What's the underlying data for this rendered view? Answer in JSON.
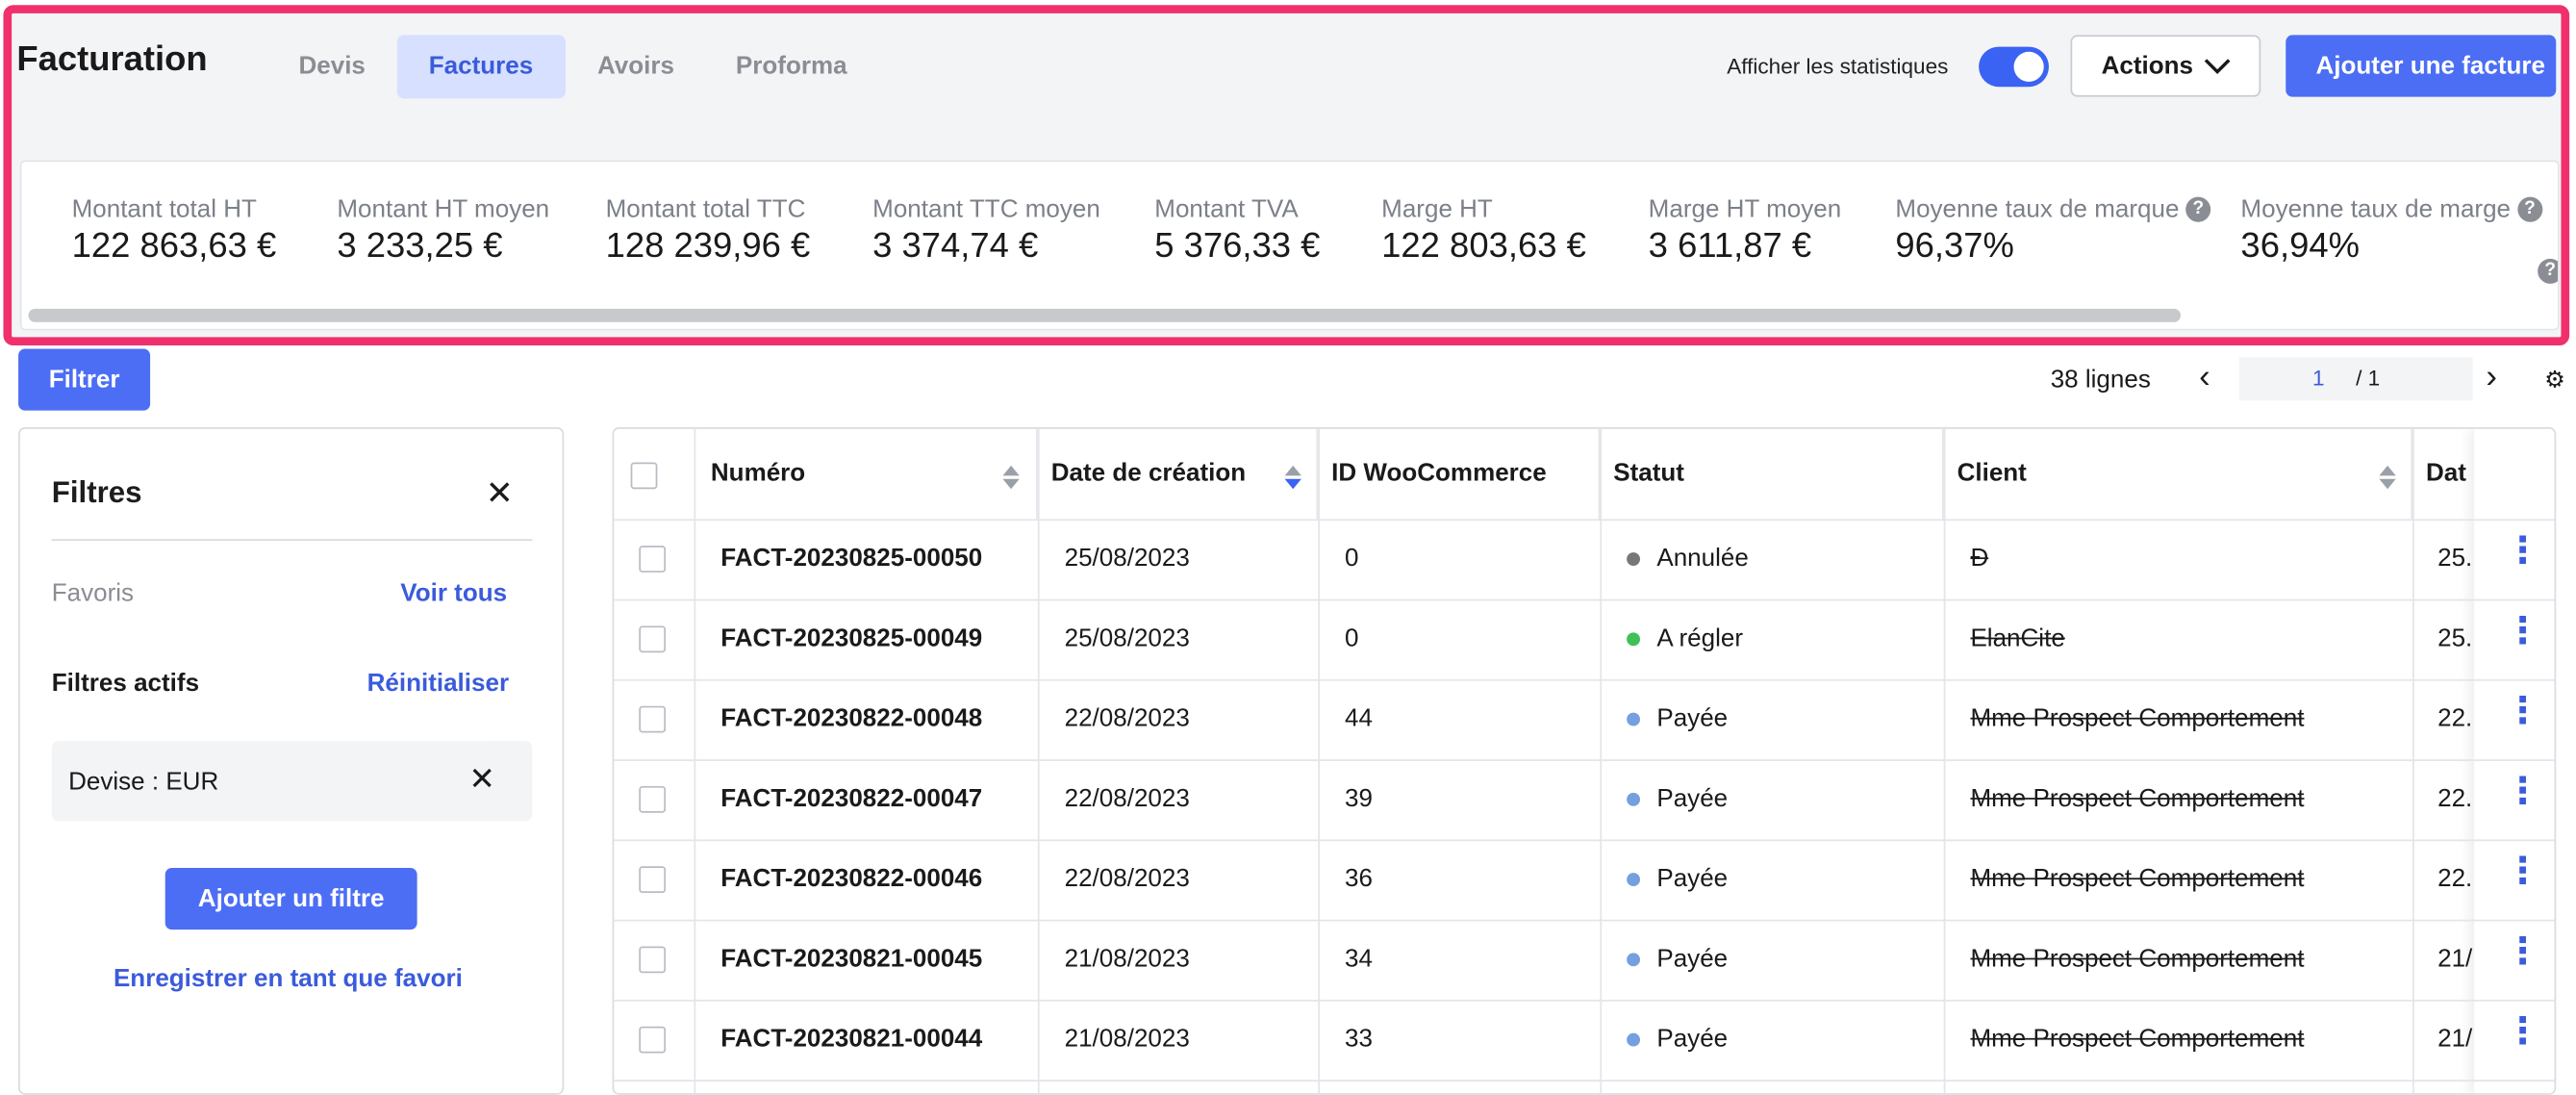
{
  "header": {
    "title": "Facturation",
    "tabs": [
      {
        "label": "Devis",
        "active": false
      },
      {
        "label": "Factures",
        "active": true
      },
      {
        "label": "Avoirs",
        "active": false
      },
      {
        "label": "Proforma",
        "active": false
      }
    ],
    "stats_toggle_label": "Afficher les statistiques",
    "stats_toggle_on": true,
    "actions_label": "Actions",
    "add_invoice_label": "Ajouter une facture",
    "accent_color": "#4c6ef5",
    "highlight_color": "#f0306c"
  },
  "stats": [
    {
      "label": "Montant total HT",
      "value": "122 863,63 €"
    },
    {
      "label": "Montant HT moyen",
      "value": "3 233,25 €"
    },
    {
      "label": "Montant total TTC",
      "value": "128 239,96 €"
    },
    {
      "label": "Montant TTC moyen",
      "value": "3 374,74 €"
    },
    {
      "label": "Montant TVA",
      "value": "5 376,33 €"
    },
    {
      "label": "Marge HT",
      "value": "122 803,63 €"
    },
    {
      "label": "Marge HT moyen",
      "value": "3 611,87 €"
    },
    {
      "label": "Moyenne taux de marque",
      "value": "96,37%"
    },
    {
      "label": "Moyenne taux de marge",
      "value": "36,94%"
    }
  ],
  "toolbar": {
    "filter_label": "Filtrer",
    "row_count": "38 lignes",
    "page_current": "1",
    "page_total": "/ 1"
  },
  "filters": {
    "title": "Filtres",
    "favorites_label": "Favoris",
    "see_all_label": "Voir tous",
    "active_filters_label": "Filtres actifs",
    "reset_label": "Réinitialiser",
    "active_filter_chip": "Devise : EUR",
    "add_filter_label": "Ajouter un filtre",
    "save_favorite_label": "Enregistrer en tant que favori"
  },
  "table": {
    "columns": [
      "Numéro",
      "Date de création",
      "ID WooCommerce",
      "Statut",
      "Client",
      "Dat"
    ],
    "rows": [
      {
        "numero": "FACT-20230825-00050",
        "date": "25/08/2023",
        "woo_id": "0",
        "statut": "Annulée",
        "status_color": "#777777",
        "client": "Ð",
        "date2": "25."
      },
      {
        "numero": "FACT-20230825-00049",
        "date": "25/08/2023",
        "woo_id": "0",
        "statut": "A régler",
        "status_color": "#40c057",
        "client": "ElanCite",
        "date2": "25."
      },
      {
        "numero": "FACT-20230822-00048",
        "date": "22/08/2023",
        "woo_id": "44",
        "statut": "Payée",
        "status_color": "#74a0e0",
        "client": "Mme Prospect Comportement",
        "date2": "22."
      },
      {
        "numero": "FACT-20230822-00047",
        "date": "22/08/2023",
        "woo_id": "39",
        "statut": "Payée",
        "status_color": "#74a0e0",
        "client": "Mme Prospect Comportement",
        "date2": "22."
      },
      {
        "numero": "FACT-20230822-00046",
        "date": "22/08/2023",
        "woo_id": "36",
        "statut": "Payée",
        "status_color": "#74a0e0",
        "client": "Mme Prospect Comportement",
        "date2": "22."
      },
      {
        "numero": "FACT-20230821-00045",
        "date": "21/08/2023",
        "woo_id": "34",
        "statut": "Payée",
        "status_color": "#74a0e0",
        "client": "Mme Prospect Comportement",
        "date2": "21/"
      },
      {
        "numero": "FACT-20230821-00044",
        "date": "21/08/2023",
        "woo_id": "33",
        "statut": "Payée",
        "status_color": "#74a0e0",
        "client": "Mme Prospect Comportement",
        "date2": "21/"
      }
    ]
  }
}
